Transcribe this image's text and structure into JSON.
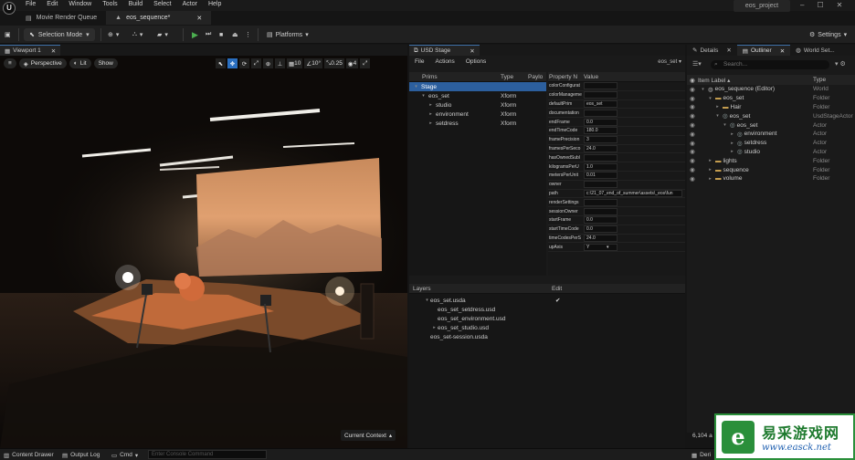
{
  "menubar": [
    "File",
    "Edit",
    "Window",
    "Tools",
    "Build",
    "Select",
    "Actor",
    "Help"
  ],
  "doc_tabs": {
    "render_queue": "Movie Render Queue",
    "sequence": "eos_sequence*"
  },
  "project_name": "eos_project",
  "toolbar": {
    "selection_mode": "Selection Mode",
    "platforms": "Platforms",
    "settings": "Settings"
  },
  "viewport": {
    "tab": "Viewport 1",
    "perspective": "Perspective",
    "lit": "Lit",
    "show": "Show",
    "grid": "10",
    "angle": "10°",
    "scale": "0.25",
    "cam": "4",
    "current_context": "Current Context"
  },
  "usd": {
    "tab": "USD Stage",
    "menu": [
      "File",
      "Actions",
      "Options"
    ],
    "layer_selector": "eos_set",
    "prims_headers": {
      "name": "Prims",
      "type": "Type",
      "payload": "Paylo"
    },
    "prims": [
      {
        "name": "Stage",
        "type": "",
        "depth": 0,
        "selected": true,
        "expand": "open"
      },
      {
        "name": "eos_set",
        "type": "Xform",
        "depth": 1,
        "expand": "open"
      },
      {
        "name": "studio",
        "type": "Xform",
        "depth": 2,
        "expand": "closed"
      },
      {
        "name": "environment",
        "type": "Xform",
        "depth": 2,
        "expand": "closed"
      },
      {
        "name": "setdress",
        "type": "Xform",
        "depth": 2,
        "expand": "closed"
      }
    ],
    "props_headers": {
      "name": "Property N",
      "value": "Value"
    },
    "props": [
      {
        "k": "colorConfigurat",
        "v": ""
      },
      {
        "k": "colorManageme",
        "v": ""
      },
      {
        "k": "defaultPrim",
        "v": "eos_set"
      },
      {
        "k": "documentation",
        "v": ""
      },
      {
        "k": "endFrame",
        "v": "0.0"
      },
      {
        "k": "endTimeCode",
        "v": "180.0"
      },
      {
        "k": "framePrecision",
        "v": "3"
      },
      {
        "k": "framesPerSeco",
        "v": "24.0"
      },
      {
        "k": "hasOwnedSubl",
        "v": ""
      },
      {
        "k": "kilogramsPerU",
        "v": "1.0"
      },
      {
        "k": "metersPerUnit",
        "v": "0.01"
      },
      {
        "k": "owner",
        "v": ""
      },
      {
        "k": "path",
        "v": "c:\\21_07_end_of_summer\\assets\\_eos\\fun",
        "wide": true
      },
      {
        "k": "renderSettings",
        "v": ""
      },
      {
        "k": "sessionOwner",
        "v": ""
      },
      {
        "k": "startFrame",
        "v": "0.0"
      },
      {
        "k": "startTimeCode",
        "v": "0.0"
      },
      {
        "k": "timeCodesPerS",
        "v": "24.0"
      },
      {
        "k": "upAxis",
        "v": "Y"
      }
    ],
    "layers_headers": {
      "name": "Layers",
      "edit": "Edit"
    },
    "layers": [
      {
        "name": "eos_set.usda",
        "depth": 0,
        "expand": "open",
        "check": "✔"
      },
      {
        "name": "eos_set_setdress.usd",
        "depth": 1,
        "expand": "",
        "check": ""
      },
      {
        "name": "eos_set_environment.usd",
        "depth": 1,
        "expand": "",
        "check": ""
      },
      {
        "name": "eos_set_studio.usd",
        "depth": 1,
        "expand": "closed",
        "check": ""
      },
      {
        "name": "eos_set-session.usda",
        "depth": 0,
        "expand": "",
        "check": ""
      }
    ]
  },
  "outliner": {
    "tabs": {
      "details": "Details",
      "outliner": "Outliner",
      "world": "World Set..."
    },
    "search_placeholder": "Search...",
    "headers": {
      "label": "Item Label ▴",
      "type": "Type"
    },
    "items": [
      {
        "name": "eos_sequence (Editor)",
        "type": "World",
        "depth": 0,
        "expand": "open",
        "icon": "world-icon"
      },
      {
        "name": "eos_set",
        "type": "Folder",
        "depth": 1,
        "expand": "open",
        "icon": "folder-icon"
      },
      {
        "name": "Hair",
        "type": "Folder",
        "depth": 2,
        "expand": "closed",
        "icon": "folder-icon"
      },
      {
        "name": "eos_set",
        "type": "UsdStageActor",
        "depth": 2,
        "expand": "open",
        "icon": "actor-icon"
      },
      {
        "name": "eos_set",
        "type": "Actor",
        "depth": 3,
        "expand": "open",
        "icon": "actor-icon"
      },
      {
        "name": "environment",
        "type": "Actor",
        "depth": 4,
        "expand": "closed",
        "icon": "actor-icon"
      },
      {
        "name": "setdress",
        "type": "Actor",
        "depth": 4,
        "expand": "closed",
        "icon": "actor-icon"
      },
      {
        "name": "studio",
        "type": "Actor",
        "depth": 4,
        "expand": "closed",
        "icon": "actor-icon"
      },
      {
        "name": "lights",
        "type": "Folder",
        "depth": 1,
        "expand": "closed",
        "icon": "folder-icon"
      },
      {
        "name": "sequence",
        "type": "Folder",
        "depth": 1,
        "expand": "closed",
        "icon": "folder-icon"
      },
      {
        "name": "volume",
        "type": "Folder",
        "depth": 1,
        "expand": "closed",
        "icon": "folder-icon"
      }
    ],
    "count": "6,104 a"
  },
  "statusbar": {
    "content_drawer": "Content Drawer",
    "output_log": "Output Log",
    "cmd": "Cmd",
    "cmd_placeholder": "Enter Console Command",
    "derived": "Deri"
  },
  "watermark": {
    "logo": "e",
    "cn": "易采游戏网",
    "url": "www.easck.net"
  }
}
